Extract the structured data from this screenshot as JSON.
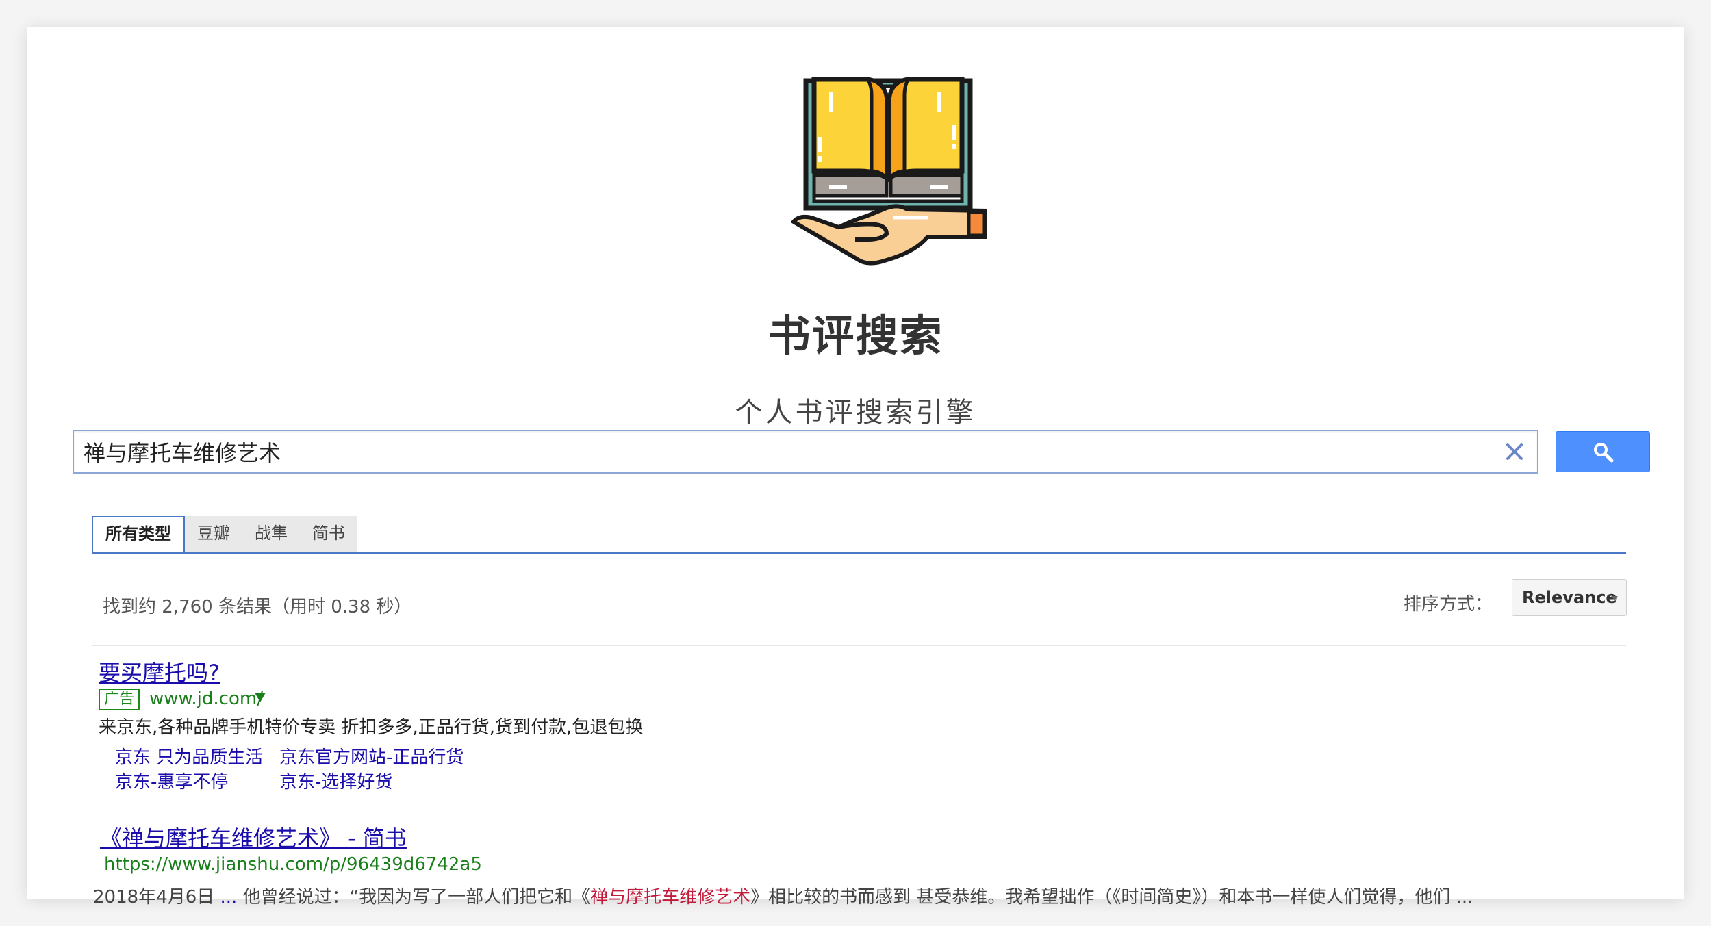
{
  "header": {
    "title": "书评搜索",
    "subtitle": "个人书评搜索引擎"
  },
  "search": {
    "query": "禅与摩托车维修艺术",
    "placeholder": ""
  },
  "tabs": [
    {
      "label": "所有类型",
      "active": true
    },
    {
      "label": "豆瓣",
      "active": false
    },
    {
      "label": "战隼",
      "active": false
    },
    {
      "label": "简书",
      "active": false
    }
  ],
  "results_info": "找到约 2,760 条结果（用时 0.38 秒）",
  "sort": {
    "label": "排序方式：",
    "selected": "Relevance"
  },
  "ad": {
    "title": "要买摩托吗?",
    "badge": "广告",
    "url": "www.jd.com/",
    "description": "来京东,各种品牌手机特价专卖 折扣多多,正品行货,货到付款,包退包换",
    "sitelinks": [
      "京东 只为品质生活",
      "京东官方网站-正品行货",
      "京东-惠享不停",
      "京东-选择好货"
    ]
  },
  "result": {
    "title": "《禅与摩托车维修艺术》 - 简书",
    "url": "https://www.jianshu.com/p/96439d6742a5",
    "date": "2018年4月6日",
    "ellipsis_start": "...",
    "snippet_before": "他曾经说过：“我因为写了一部人们把它和《",
    "snippet_highlight": "禅与摩托车维修艺术",
    "snippet_after": "》相比较的书而感到 甚受恭维。我希望拙作（《时间简史》）和本书一样使人们觉得，他们 ..."
  },
  "colors": {
    "accent": "#4d90fe",
    "link": "#1a0dab",
    "url_green": "#1a7f1a",
    "highlight": "#c11a3a"
  },
  "icons": {
    "logo": "book-hand-icon",
    "clear": "close-icon",
    "search": "search-icon"
  }
}
